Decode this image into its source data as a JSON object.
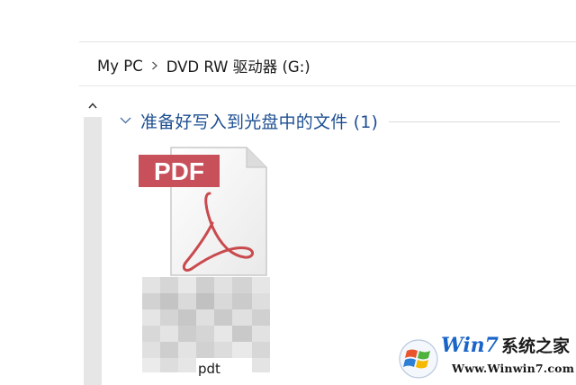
{
  "breadcrumb": {
    "items": [
      "My PC",
      "DVD RW 驱动器 (G:)"
    ]
  },
  "group": {
    "title": "准备好写入到光盘中的文件 (1)"
  },
  "file": {
    "icon_badge": "PDF",
    "label": "pdt",
    "icon": "pdf-file-icon"
  },
  "watermark": {
    "title_brand": "Win7",
    "title_suffix": "系统之家",
    "url": "Www.Winwin7.com"
  },
  "colors": {
    "group_title": "#1d4f91",
    "pdf_badge": "#c8505a",
    "pdf_glyph": "#c94a4e"
  }
}
